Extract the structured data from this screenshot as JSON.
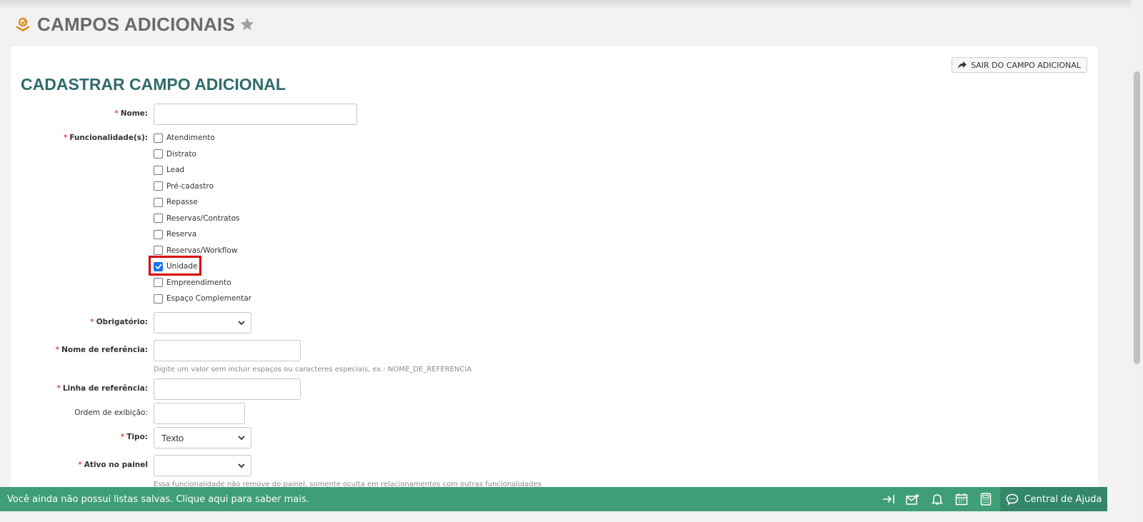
{
  "page": {
    "title": "CAMPOS ADICIONAIS"
  },
  "toolbar": {
    "exit_label": "SAIR DO CAMPO ADICIONAL"
  },
  "form": {
    "title": "CADASTRAR CAMPO ADICIONAL",
    "required_mark": "*",
    "nome": {
      "label": "Nome:",
      "value": ""
    },
    "funcionalidades": {
      "label": "Funcionalidade(s):",
      "options": [
        {
          "label": "Atendimento",
          "checked": false
        },
        {
          "label": "Distrato",
          "checked": false
        },
        {
          "label": "Lead",
          "checked": false
        },
        {
          "label": "Pré-cadastro",
          "checked": false
        },
        {
          "label": "Repasse",
          "checked": false
        },
        {
          "label": "Reservas/Contratos",
          "checked": false
        },
        {
          "label": "Reserva",
          "checked": false
        },
        {
          "label": "Reservas/Workflow",
          "checked": false
        },
        {
          "label": "Unidade",
          "checked": true
        },
        {
          "label": "Empreendimento",
          "checked": false
        },
        {
          "label": "Espaço Complementar",
          "checked": false
        }
      ]
    },
    "obrigatorio": {
      "label": "Obrigatório:",
      "value": ""
    },
    "nome_referencia": {
      "label": "Nome de referência:",
      "value": "",
      "hint": "Digite um valor sem incluir espaços ou caracteres especiais, ex.: NOME_DE_REFERENCIA"
    },
    "linha_referencia": {
      "label": "Linha de referência:",
      "value": ""
    },
    "ordem_exibicao": {
      "label": "Ordem de exibição:",
      "value": ""
    },
    "tipo": {
      "label": "Tipo:",
      "value": "Texto"
    },
    "ativo_painel": {
      "label": "Ativo no painel",
      "value": "",
      "hint": "Essa funcionalidade não remove do painel, somente oculta em relacionamentos com outras funcionalidades"
    }
  },
  "footer": {
    "message": "Você ainda não possui listas salvas. Clique aqui para saber mais.",
    "help_label": "Central de Ajuda",
    "icons": [
      "collapse-icon",
      "mail-star-icon",
      "bell-icon",
      "calendar-icon",
      "calculator-icon"
    ]
  },
  "colors": {
    "footer": "#3f9e77",
    "help": "#33866a",
    "title_teal": "#2f6b6b",
    "highlight": "#d60000",
    "checkbox_checked": "#1a73e8"
  }
}
